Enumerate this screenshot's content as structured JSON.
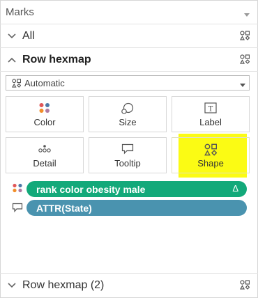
{
  "header": {
    "title": "Marks"
  },
  "sections": {
    "all": {
      "label": "All"
    },
    "row_hexmap": {
      "label": "Row hexmap"
    },
    "row_hexmap_2": {
      "label": "Row hexmap (2)"
    }
  },
  "mark_type": {
    "selected": "Automatic"
  },
  "cards": {
    "color": "Color",
    "size": "Size",
    "label": "Label",
    "detail": "Detail",
    "tooltip": "Tooltip",
    "shape": "Shape"
  },
  "fields": [
    {
      "label": "rank color obesity male",
      "badge": "Δ",
      "color": "#13a97a",
      "icon": "color-dots-icon"
    },
    {
      "label": "ATTR(State)",
      "color": "#4a93af",
      "icon": "tooltip-icon"
    }
  ],
  "colors": {
    "highlight": "#fbfb14",
    "pill_green": "#13a97a",
    "pill_blue": "#4a93af"
  }
}
